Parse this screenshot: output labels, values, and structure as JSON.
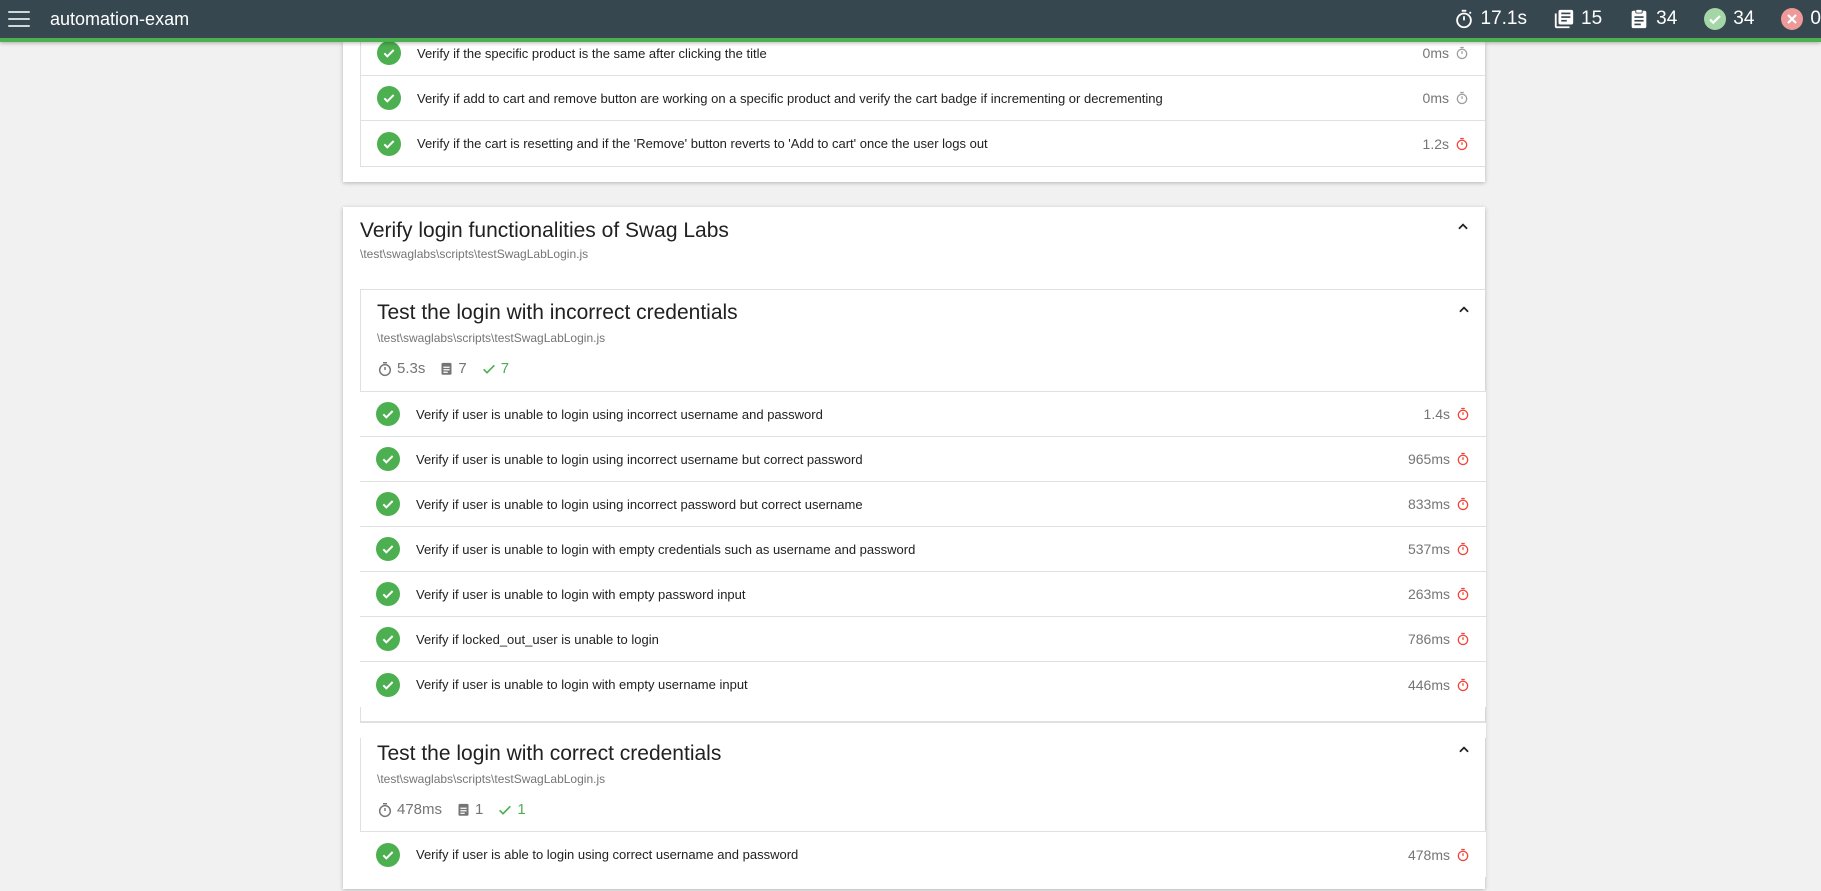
{
  "header": {
    "title": "automation-exam",
    "stats": {
      "duration": "17.1s",
      "suites": "15",
      "tests": "34",
      "passed": "34",
      "failed": "0"
    }
  },
  "colors": {
    "topbar": "#37474f",
    "accent": "#4caf50",
    "failed": "#f44336",
    "slow": "#f44336"
  },
  "top_tests": [
    {
      "title": "Verify if the specific product is the same after clicking the title",
      "duration": "0ms",
      "timer": "normal"
    },
    {
      "title": "Verify if add to cart and remove button are working on a specific product and verify the cart badge if incrementing or decrementing",
      "duration": "0ms",
      "timer": "normal"
    },
    {
      "title": "Verify if the cart is resetting and if the 'Remove' button reverts to 'Add to cart' once the user logs out",
      "duration": "1.2s",
      "timer": "slow"
    }
  ],
  "suite": {
    "title": "Verify login functionalities of Swag Labs",
    "file": "\\test\\swaglabs\\scripts\\testSwagLabLogin.js",
    "subsuites": [
      {
        "title": "Test the login with incorrect credentials",
        "file": "\\test\\swaglabs\\scripts\\testSwagLabLogin.js",
        "duration": "5.3s",
        "tests_count": "7",
        "passed_count": "7",
        "tests": [
          {
            "title": "Verify if user is unable to login using incorrect username and password",
            "duration": "1.4s",
            "timer": "slow"
          },
          {
            "title": "Verify if user is unable to login using incorrect username but correct password",
            "duration": "965ms",
            "timer": "slow"
          },
          {
            "title": "Verify if user is unable to login using incorrect password but correct username",
            "duration": "833ms",
            "timer": "slow"
          },
          {
            "title": "Verify if user is unable to login with empty credentials such as username and password",
            "duration": "537ms",
            "timer": "slow"
          },
          {
            "title": "Verify if user is unable to login with empty password input",
            "duration": "263ms",
            "timer": "slow"
          },
          {
            "title": "Verify if locked_out_user is unable to login",
            "duration": "786ms",
            "timer": "slow"
          },
          {
            "title": "Verify if user is unable to login with empty username input",
            "duration": "446ms",
            "timer": "slow"
          }
        ]
      },
      {
        "title": "Test the login with correct credentials",
        "file": "\\test\\swaglabs\\scripts\\testSwagLabLogin.js",
        "duration": "478ms",
        "tests_count": "1",
        "passed_count": "1",
        "tests": [
          {
            "title": "Verify if user is able to login using correct username and password",
            "duration": "478ms",
            "timer": "slow"
          }
        ]
      }
    ]
  }
}
